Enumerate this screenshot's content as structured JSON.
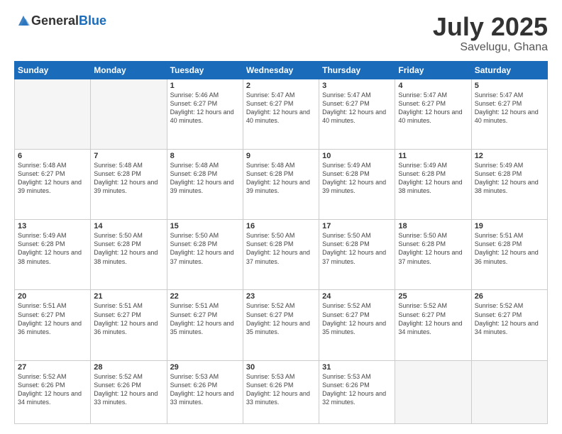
{
  "header": {
    "logo_general": "General",
    "logo_blue": "Blue",
    "title": "July 2025",
    "location": "Savelugu, Ghana"
  },
  "days_of_week": [
    "Sunday",
    "Monday",
    "Tuesday",
    "Wednesday",
    "Thursday",
    "Friday",
    "Saturday"
  ],
  "weeks": [
    [
      {
        "day": "",
        "empty": true
      },
      {
        "day": "",
        "empty": true
      },
      {
        "day": "1",
        "sunrise": "5:46 AM",
        "sunset": "6:27 PM",
        "daylight": "12 hours and 40 minutes."
      },
      {
        "day": "2",
        "sunrise": "5:47 AM",
        "sunset": "6:27 PM",
        "daylight": "12 hours and 40 minutes."
      },
      {
        "day": "3",
        "sunrise": "5:47 AM",
        "sunset": "6:27 PM",
        "daylight": "12 hours and 40 minutes."
      },
      {
        "day": "4",
        "sunrise": "5:47 AM",
        "sunset": "6:27 PM",
        "daylight": "12 hours and 40 minutes."
      },
      {
        "day": "5",
        "sunrise": "5:47 AM",
        "sunset": "6:27 PM",
        "daylight": "12 hours and 40 minutes."
      }
    ],
    [
      {
        "day": "6",
        "sunrise": "5:48 AM",
        "sunset": "6:27 PM",
        "daylight": "12 hours and 39 minutes."
      },
      {
        "day": "7",
        "sunrise": "5:48 AM",
        "sunset": "6:28 PM",
        "daylight": "12 hours and 39 minutes."
      },
      {
        "day": "8",
        "sunrise": "5:48 AM",
        "sunset": "6:28 PM",
        "daylight": "12 hours and 39 minutes."
      },
      {
        "day": "9",
        "sunrise": "5:48 AM",
        "sunset": "6:28 PM",
        "daylight": "12 hours and 39 minutes."
      },
      {
        "day": "10",
        "sunrise": "5:49 AM",
        "sunset": "6:28 PM",
        "daylight": "12 hours and 39 minutes."
      },
      {
        "day": "11",
        "sunrise": "5:49 AM",
        "sunset": "6:28 PM",
        "daylight": "12 hours and 38 minutes."
      },
      {
        "day": "12",
        "sunrise": "5:49 AM",
        "sunset": "6:28 PM",
        "daylight": "12 hours and 38 minutes."
      }
    ],
    [
      {
        "day": "13",
        "sunrise": "5:49 AM",
        "sunset": "6:28 PM",
        "daylight": "12 hours and 38 minutes."
      },
      {
        "day": "14",
        "sunrise": "5:50 AM",
        "sunset": "6:28 PM",
        "daylight": "12 hours and 38 minutes."
      },
      {
        "day": "15",
        "sunrise": "5:50 AM",
        "sunset": "6:28 PM",
        "daylight": "12 hours and 37 minutes."
      },
      {
        "day": "16",
        "sunrise": "5:50 AM",
        "sunset": "6:28 PM",
        "daylight": "12 hours and 37 minutes."
      },
      {
        "day": "17",
        "sunrise": "5:50 AM",
        "sunset": "6:28 PM",
        "daylight": "12 hours and 37 minutes."
      },
      {
        "day": "18",
        "sunrise": "5:50 AM",
        "sunset": "6:28 PM",
        "daylight": "12 hours and 37 minutes."
      },
      {
        "day": "19",
        "sunrise": "5:51 AM",
        "sunset": "6:28 PM",
        "daylight": "12 hours and 36 minutes."
      }
    ],
    [
      {
        "day": "20",
        "sunrise": "5:51 AM",
        "sunset": "6:27 PM",
        "daylight": "12 hours and 36 minutes."
      },
      {
        "day": "21",
        "sunrise": "5:51 AM",
        "sunset": "6:27 PM",
        "daylight": "12 hours and 36 minutes."
      },
      {
        "day": "22",
        "sunrise": "5:51 AM",
        "sunset": "6:27 PM",
        "daylight": "12 hours and 35 minutes."
      },
      {
        "day": "23",
        "sunrise": "5:52 AM",
        "sunset": "6:27 PM",
        "daylight": "12 hours and 35 minutes."
      },
      {
        "day": "24",
        "sunrise": "5:52 AM",
        "sunset": "6:27 PM",
        "daylight": "12 hours and 35 minutes."
      },
      {
        "day": "25",
        "sunrise": "5:52 AM",
        "sunset": "6:27 PM",
        "daylight": "12 hours and 34 minutes."
      },
      {
        "day": "26",
        "sunrise": "5:52 AM",
        "sunset": "6:27 PM",
        "daylight": "12 hours and 34 minutes."
      }
    ],
    [
      {
        "day": "27",
        "sunrise": "5:52 AM",
        "sunset": "6:26 PM",
        "daylight": "12 hours and 34 minutes."
      },
      {
        "day": "28",
        "sunrise": "5:52 AM",
        "sunset": "6:26 PM",
        "daylight": "12 hours and 33 minutes."
      },
      {
        "day": "29",
        "sunrise": "5:53 AM",
        "sunset": "6:26 PM",
        "daylight": "12 hours and 33 minutes."
      },
      {
        "day": "30",
        "sunrise": "5:53 AM",
        "sunset": "6:26 PM",
        "daylight": "12 hours and 33 minutes."
      },
      {
        "day": "31",
        "sunrise": "5:53 AM",
        "sunset": "6:26 PM",
        "daylight": "12 hours and 32 minutes."
      },
      {
        "day": "",
        "empty": true
      },
      {
        "day": "",
        "empty": true
      }
    ]
  ]
}
